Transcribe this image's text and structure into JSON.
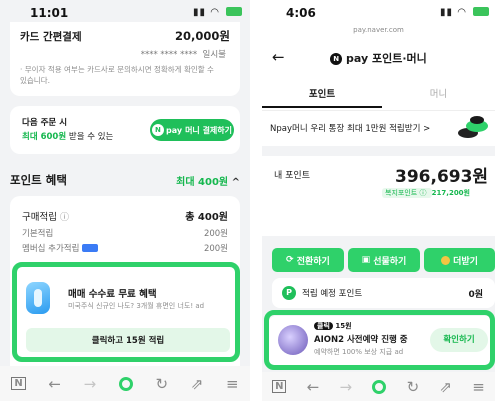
{
  "left": {
    "time": "11:01",
    "card_pay": {
      "label": "카드 간편결제",
      "amount": "20,000원",
      "card_number": "**** **** ****",
      "installment": "일시불",
      "note": "· 무이자 적용 여부는 카드사로 문의하시면 정확하게 확인할 수 있습니다."
    },
    "next_order": {
      "line1": "다음 주문 시",
      "line2_highlight": "최대 600원",
      "line2_rest": " 받을 수 있는",
      "button_label": "머니 결제하기"
    },
    "point_benefit": {
      "title": "포인트 혜택",
      "max_label": "최대 400원"
    },
    "purchase_points": {
      "title": "구매적립",
      "total": "총 400원",
      "rows": [
        {
          "label": "기본적립",
          "value": "200원"
        },
        {
          "label": "멤버십 추가적립",
          "value": "200원"
        }
      ]
    },
    "promo": {
      "title": "매매 수수료 무료 혜택",
      "subtitle": "미국주식 신규인 나도? 3개월 휴면인 너도!",
      "ad_mark": "ad",
      "button_label": "클릭하고 15원 적립"
    }
  },
  "right": {
    "time": "4:06",
    "url": "pay.naver.com",
    "page_title": "포인트·머니",
    "tabs": [
      {
        "label": "포인트",
        "active": true
      },
      {
        "label": "머니",
        "active": false
      }
    ],
    "banner": "Npay머니 우리 통장 최대 1만원 적립받기 >",
    "my_points": {
      "label": "내 포인트",
      "value": "396,693원",
      "welfare_label": "복지포인트",
      "welfare_value": "217,200원"
    },
    "actions": [
      {
        "label": "전환하기"
      },
      {
        "label": "선물하기"
      },
      {
        "label": "더받기"
      }
    ],
    "expected": {
      "label": "적립 예정 포인트",
      "value": "0원"
    },
    "ad": {
      "badge": "클릭",
      "reward": "15원",
      "title": "AION2 사전예약 진행 중",
      "subtitle": "예약하면 100% 보상 지급",
      "ad_mark": "ad",
      "button_label": "확인하기"
    }
  },
  "brand": {
    "npay": "pay"
  },
  "colors": {
    "naver_green": "#15b74e",
    "highlight_green": "#2fd16a",
    "text_dark": "#1a1a1a"
  }
}
